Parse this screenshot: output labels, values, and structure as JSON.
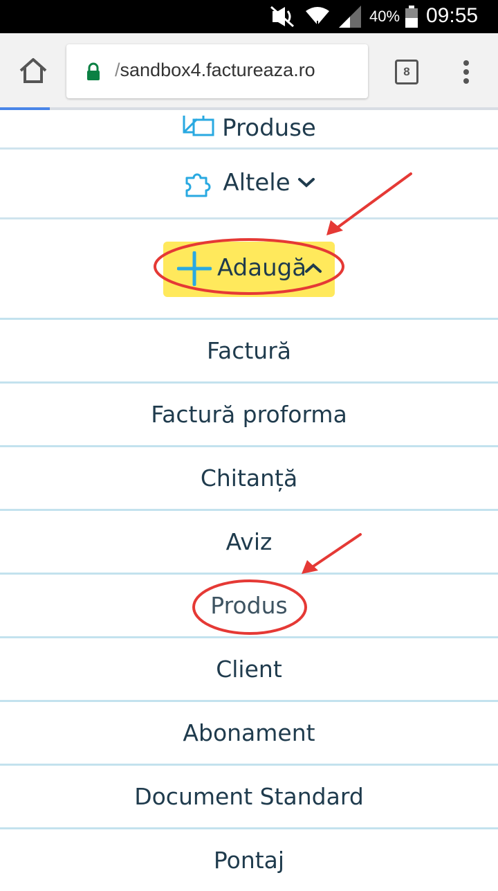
{
  "status_bar": {
    "battery_percent": "40%",
    "time": "09:55",
    "icons": [
      "mute-icon",
      "wifi-icon",
      "signal-icon",
      "battery-icon"
    ]
  },
  "browser": {
    "url_prefix": "/",
    "url_host": "sandbox4.factureaza.ro",
    "tab_count": "8",
    "icons": [
      "home-icon",
      "lock-icon",
      "tabs-icon",
      "more-vert-icon"
    ]
  },
  "nav": {
    "produse_label": "Produse",
    "altele_label": "Altele",
    "adauga_label": "Adaugă"
  },
  "submenu": {
    "items": [
      {
        "label": "Factură"
      },
      {
        "label": "Factură proforma"
      },
      {
        "label": "Chitanță"
      },
      {
        "label": "Aviz"
      },
      {
        "label": "Produs"
      },
      {
        "label": "Client"
      },
      {
        "label": "Abonament"
      },
      {
        "label": "Document Standard"
      },
      {
        "label": "Pontaj"
      }
    ]
  },
  "colors": {
    "highlight": "#ffe95c",
    "annotation": "#e53935",
    "icon_accent": "#29a9e1",
    "submenu_bg": "#e6f0f6",
    "text": "#1f3b4d"
  }
}
